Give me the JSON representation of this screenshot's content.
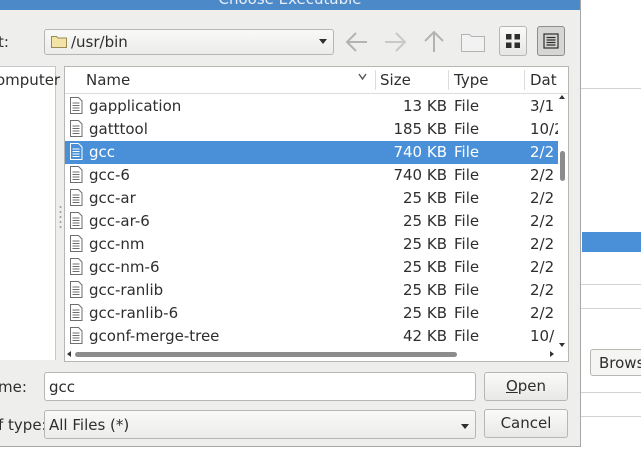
{
  "dialog": {
    "title": "Choose Executable",
    "location_label": "t:",
    "path": "/usr/bin",
    "places": [
      "omputer"
    ],
    "name_label": "me:",
    "name_value": "gcc",
    "type_label": "f type:",
    "type_value": "All Files (*)",
    "open_label": "Open",
    "open_mnemonic": "O",
    "open_rest": "pen",
    "cancel_label": "Cancel"
  },
  "toolbar": {
    "icons": [
      "back-arrow-icon",
      "forward-arrow-icon",
      "up-arrow-icon",
      "new-folder-icon",
      "icon-view-icon",
      "list-view-icon"
    ]
  },
  "columns": [
    "Name",
    "Size",
    "Type",
    "Dat"
  ],
  "files": [
    {
      "name": "gapplication",
      "size": "13 KB",
      "type": "File",
      "date": "3/1",
      "selected": false
    },
    {
      "name": "gatttool",
      "size": "185 KB",
      "type": "File",
      "date": "10/2",
      "selected": false
    },
    {
      "name": "gcc",
      "size": "740 KB",
      "type": "File",
      "date": "2/2",
      "selected": true
    },
    {
      "name": "gcc-6",
      "size": "740 KB",
      "type": "File",
      "date": "2/2",
      "selected": false
    },
    {
      "name": "gcc-ar",
      "size": "25 KB",
      "type": "File",
      "date": "2/2",
      "selected": false
    },
    {
      "name": "gcc-ar-6",
      "size": "25 KB",
      "type": "File",
      "date": "2/2",
      "selected": false
    },
    {
      "name": "gcc-nm",
      "size": "25 KB",
      "type": "File",
      "date": "2/2",
      "selected": false
    },
    {
      "name": "gcc-nm-6",
      "size": "25 KB",
      "type": "File",
      "date": "2/2",
      "selected": false
    },
    {
      "name": "gcc-ranlib",
      "size": "25 KB",
      "type": "File",
      "date": "2/2",
      "selected": false
    },
    {
      "name": "gcc-ranlib-6",
      "size": "25 KB",
      "type": "File",
      "date": "2/2",
      "selected": false
    },
    {
      "name": "gconf-merge-tree",
      "size": "42 KB",
      "type": "File",
      "date": "10/",
      "selected": false
    }
  ],
  "background": {
    "browse_label": "Brows"
  },
  "colors": {
    "selection": "#4a90d9",
    "titlebar": "#4c89c9",
    "dialog_bg": "#eeeeec"
  }
}
